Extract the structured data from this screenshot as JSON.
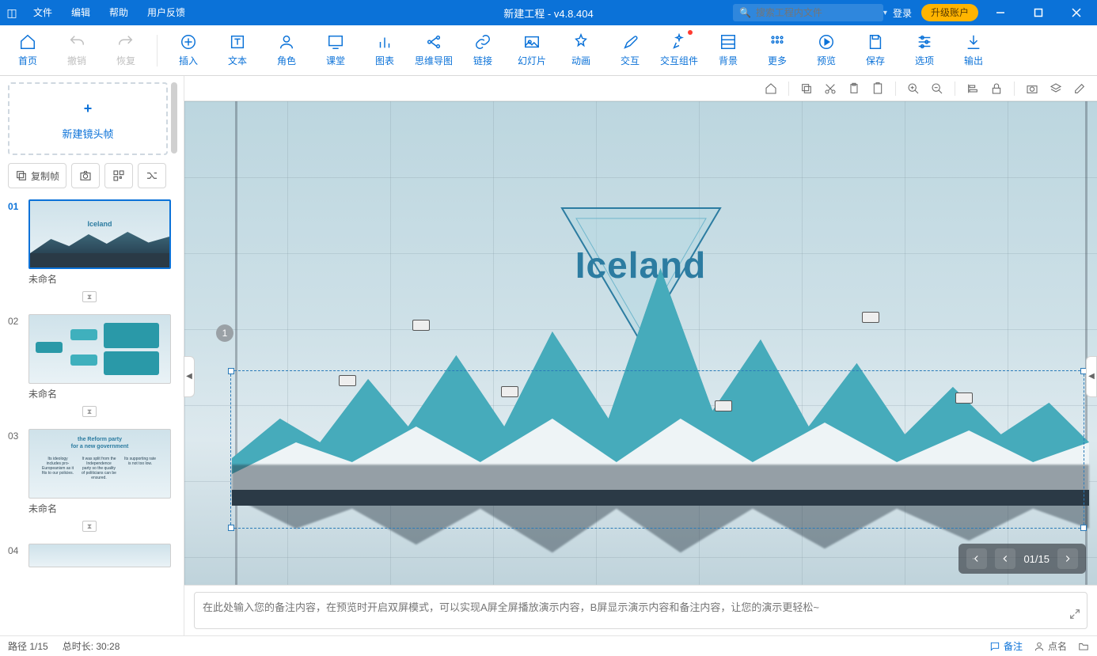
{
  "titlebar": {
    "menus": [
      "文件",
      "编辑",
      "帮助",
      "用户反馈"
    ],
    "title": "新建工程 - v4.8.404",
    "search_placeholder": "搜索工程内文件",
    "login": "登录",
    "upgrade": "升级账户"
  },
  "ribbon": {
    "items": [
      {
        "key": "home",
        "label": "首页"
      },
      {
        "key": "undo",
        "label": "撤销",
        "gray": true
      },
      {
        "key": "redo",
        "label": "恢复",
        "gray": true
      },
      {
        "key": "sep"
      },
      {
        "key": "insert",
        "label": "插入"
      },
      {
        "key": "text",
        "label": "文本"
      },
      {
        "key": "role",
        "label": "角色"
      },
      {
        "key": "class",
        "label": "课堂"
      },
      {
        "key": "chart",
        "label": "图表"
      },
      {
        "key": "mind",
        "label": "思维导图"
      },
      {
        "key": "link",
        "label": "链接"
      },
      {
        "key": "slide",
        "label": "幻灯片"
      },
      {
        "key": "anim",
        "label": "动画"
      },
      {
        "key": "inter",
        "label": "交互"
      },
      {
        "key": "icomp",
        "label": "交互组件",
        "dot": true
      },
      {
        "key": "bg",
        "label": "背景"
      },
      {
        "key": "more",
        "label": "更多"
      },
      {
        "key": "preview",
        "label": "预览"
      },
      {
        "key": "save",
        "label": "保存"
      },
      {
        "key": "option",
        "label": "选项"
      },
      {
        "key": "export",
        "label": "输出"
      }
    ]
  },
  "sidebar": {
    "newframe": "新建镜头帧",
    "copyframe": "复制帧",
    "slides": [
      {
        "num": "01",
        "caption": "未命名",
        "active": true,
        "type": "th1",
        "title": "Iceland"
      },
      {
        "num": "02",
        "caption": "未命名",
        "type": "th2"
      },
      {
        "num": "03",
        "caption": "未命名",
        "type": "th3",
        "h1": "the Reform party",
        "h2": "for a new government"
      },
      {
        "num": "04",
        "caption": "",
        "type": "th4"
      }
    ]
  },
  "canvas": {
    "title_text": "Iceland",
    "badge": "1",
    "nav_counter": "01/15"
  },
  "notes": {
    "placeholder": "在此处输入您的备注内容，在预览时开启双屏模式，可以实现A屏全屏播放演示内容，B屏显示演示内容和备注内容，让您的演示更轻松~"
  },
  "status": {
    "path": "路径 1/15",
    "duration": "总时长: 30:28",
    "remark": "备注",
    "roll": "点名"
  },
  "colors": {
    "primary": "#0b72d8",
    "accent": "#ffb400",
    "teal": "#2c7ca1"
  }
}
